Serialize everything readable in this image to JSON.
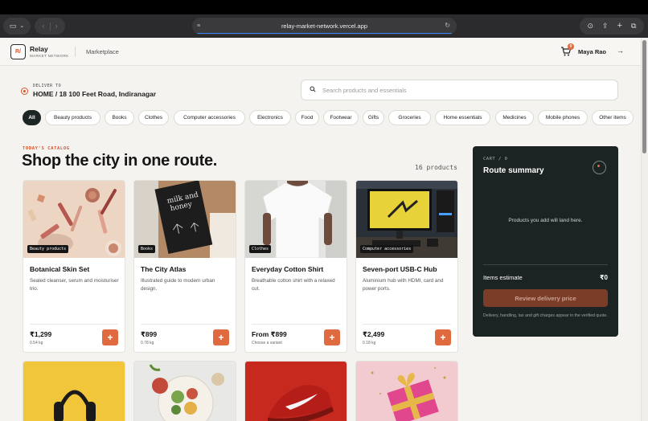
{
  "browser": {
    "url": "relay-market-network.vercel.app"
  },
  "header": {
    "logo_mark": "R/",
    "brand_name": "Relay",
    "brand_sub": "MARKET NETWORK",
    "nav_label": "Marketplace",
    "cart_badge": "0",
    "user_name": "Maya Rao"
  },
  "delivery": {
    "label": "DELIVER TO",
    "address": "HOME / 18 100 Feet Road, Indiranagar"
  },
  "search": {
    "placeholder": "Search products and essentials"
  },
  "categories": [
    "All",
    "Beauty products",
    "Books",
    "Clothes",
    "Computer accessories",
    "Electronics",
    "Food",
    "Footwear",
    "Gifts",
    "Groceries",
    "Home essentials",
    "Medicines",
    "Mobile phones",
    "Other items"
  ],
  "catalog": {
    "kicker": "TODAY'S CATALOG",
    "title": "Shop the city in one route.",
    "count": "16 products"
  },
  "products": [
    {
      "tag": "Beauty products",
      "name": "Botanical Skin Set",
      "desc": "Sealed cleanser, serum and moisturiser trio.",
      "price": "₹1,299",
      "sub": "0.54 kg",
      "add": "+"
    },
    {
      "tag": "Books",
      "name": "The City Atlas",
      "desc": "Illustrated guide to modern urban design.",
      "price": "₹899",
      "sub": "0.78 kg",
      "add": "+"
    },
    {
      "tag": "Clothes",
      "name": "Everyday Cotton Shirt",
      "desc": "Breathable cotton shirt with a relaxed cut.",
      "price": "From ₹899",
      "sub": "Choose a variant",
      "add": "+"
    },
    {
      "tag": "Computer accessories",
      "name": "Seven-port USB-C Hub",
      "desc": "Aluminium hub with HDMI, card and power ports.",
      "price": "₹2,499",
      "sub": "0.18 kg",
      "add": "+"
    }
  ],
  "book_cover": {
    "line1": "milk and",
    "line2": "honey"
  },
  "cart": {
    "label": "CART / 0",
    "title": "Route summary",
    "empty_text": "Products you add will land here.",
    "estimate_label": "Items estimate",
    "estimate_value": "₹0",
    "button_label": "Review delivery price",
    "note": "Delivery, handling, tax and gift charges appear in the verified quote."
  },
  "colors": {
    "accent": "#e06a3f",
    "dark_panel": "#1b2422",
    "page_bg": "#f4f3ef"
  }
}
